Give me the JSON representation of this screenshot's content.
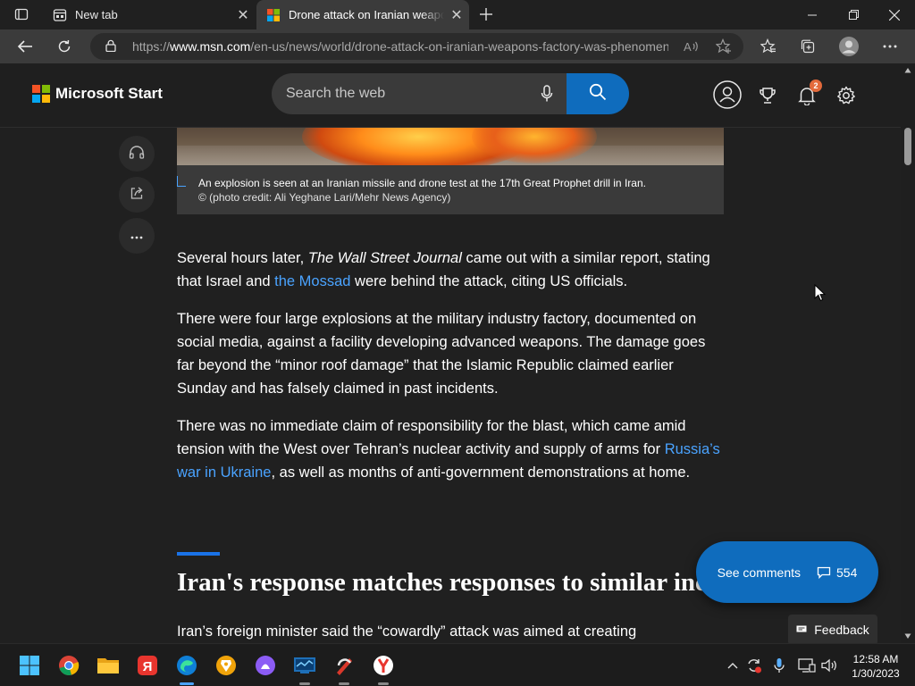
{
  "browser": {
    "tabs": [
      {
        "title": "New tab"
      },
      {
        "title": "Drone attack on Iranian weapons factory was phenomenal success"
      }
    ],
    "url": {
      "prefix": "https://",
      "domain": "www.msn.com",
      "path": "/en-us/news/world/drone-attack-on-iranian-weapons-factory-was-phenomenal"
    }
  },
  "header": {
    "brand": "Microsoft Start",
    "search_placeholder": "Search the web",
    "notification_count": "2",
    "colors": {
      "accent": "#0f6cbd",
      "badge": "#e36a3b"
    }
  },
  "article": {
    "caption": "An explosion is seen at an Iranian missile and drone test at the 17th Great Prophet drill in Iran.",
    "credit": "© (photo credit: Ali Yeghane Lari/Mehr News Agency)",
    "p1": {
      "a": "Several hours later, ",
      "b": "The Wall Street Journal",
      "c": " came out with a similar report, stating that Israel and ",
      "link": "the Mossad",
      "d": " were behind the attack, citing US officials."
    },
    "p2": "There were four large explosions at the military industry factory, documented on social media, against a facility developing advanced weapons. The damage goes far beyond the “minor roof damage” that the Islamic Republic claimed earlier Sunday and has falsely claimed in past incidents.",
    "p3": {
      "a": "There was no immediate claim of responsibility for the blast, which came amid tension with the West over Tehran’s nuclear activity and supply of arms for ",
      "link": "Russia’s war in Ukraine",
      "b": ", as well as months of anti-government demonstrations at home."
    },
    "heading": "Iran's response matches responses to similar incidents",
    "p4": "Iran’s foreign minister said the “cowardly” attack was aimed at creating"
  },
  "comments": {
    "label": "See comments",
    "count": "554"
  },
  "feedback": {
    "label": "Feedback"
  },
  "taskbar": {
    "time": "12:58 AM",
    "date": "1/30/2023"
  }
}
